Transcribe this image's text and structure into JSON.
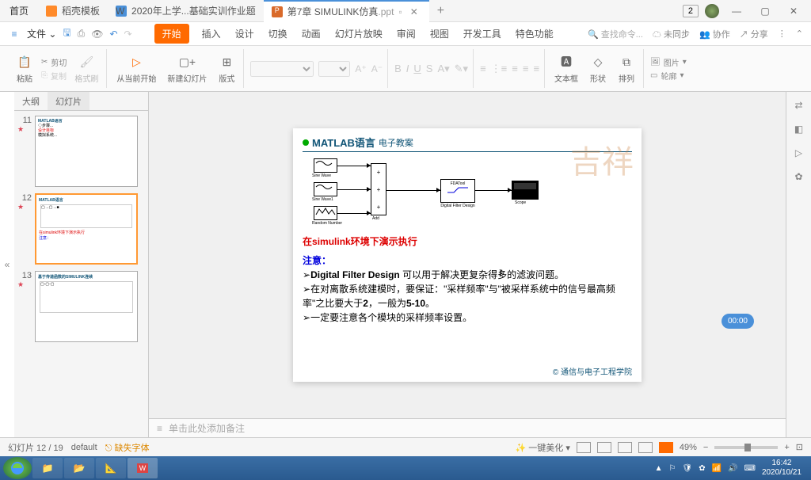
{
  "titlebar": {
    "home": "首页",
    "tab1": "稻壳模板",
    "tab2": "2020年上学...基础实训作业题",
    "tab3_prefix": "第7章 SIMULINK仿真",
    "tab3_ext": ".ppt",
    "badge": "2"
  },
  "menubar": {
    "file": "文件",
    "tabs": [
      "开始",
      "插入",
      "设计",
      "切换",
      "动画",
      "幻灯片放映",
      "审阅",
      "视图",
      "开发工具",
      "特色功能"
    ],
    "search_placeholder": "查找命令...",
    "unsync": "未同步",
    "collab": "协作",
    "share": "分享"
  },
  "toolbar": {
    "paste": "粘贴",
    "cut": "剪切",
    "copy": "复制",
    "format_painter": "格式刷",
    "from_current": "从当前开始",
    "new_slide": "新建幻灯片",
    "layout": "版式",
    "textbox": "文本框",
    "shape": "形状",
    "arrange": "排列",
    "image": "图片",
    "outline": "轮廓"
  },
  "sidebar": {
    "tab_outline": "大纲",
    "tab_slides": "幻灯片",
    "nums": [
      "11",
      "12",
      "13"
    ]
  },
  "slide": {
    "title": "MATLAB语言",
    "subtitle": "电子教案",
    "blocks": {
      "sine1": "Sine Wave",
      "sine2": "Sine Wave1",
      "random": "Random Number",
      "add": "Add",
      "filter": "Digital Filter Design",
      "fda": "FDATool",
      "scope": "Scope"
    },
    "line1_a": "在",
    "line1_b": "simulink",
    "line1_c": "环境下演示执行",
    "note_label": "注意：",
    "bullet1_a": "Digital Filter Design ",
    "bullet1_b": "可以用于解决更复杂得多的滤波问题。",
    "bullet2_a": "在对离散系统建模时，要保证：\"采样频率\"与\"被采样系统中的信号最高频率\"之比要大于",
    "bullet2_b": "2",
    "bullet2_c": "，一般为",
    "bullet2_d": "5-10",
    "bullet2_e": "。",
    "bullet3": "一定要注意各个模块的采样频率设置。",
    "copyright": "© 通信与电子工程学院"
  },
  "notes": {
    "placeholder": "单击此处添加备注"
  },
  "timer": "00:00",
  "statusbar": {
    "slide_info": "幻灯片 12 / 19",
    "theme": "default",
    "missing_fonts": "缺失字体",
    "beautify": "一键美化",
    "zoom": "49%"
  },
  "taskbar": {
    "time": "16:42",
    "date": "2020/10/21"
  }
}
